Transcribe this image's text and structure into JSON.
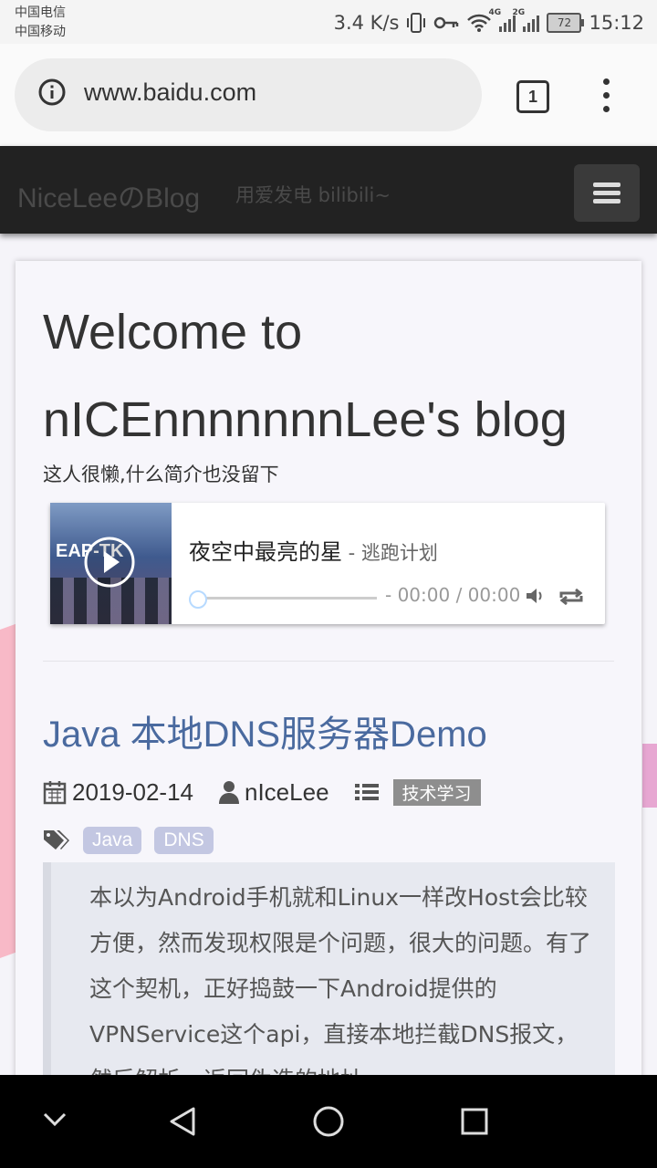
{
  "status": {
    "carrier1": "中国电信",
    "carrier2": "中国移动",
    "speed": "3.4 K/s",
    "net1": "4G",
    "net2": "2G",
    "battery": "72",
    "time": "15:12"
  },
  "browser": {
    "url": "www.baidu.com",
    "tab_count": "1"
  },
  "site": {
    "brand": "NiceLeeのBlog",
    "tagline": "用爱发电 bilibili~"
  },
  "intro": {
    "title": "Welcome to nICEnnnnnnnLee's blog",
    "description": "这人很懒,什么简介也没留下"
  },
  "player": {
    "cover_text": "EAP-TK",
    "song": "夜空中最亮的星",
    "artist": " - 逃跑计划",
    "time": "- 00:00 / 00:00",
    "progress": 0
  },
  "post": {
    "title": "Java 本地DNS服务器Demo",
    "date": "2019-02-14",
    "author": "nIceLee",
    "category": "技术学习",
    "tags": [
      "Java",
      "DNS"
    ],
    "excerpt": "本以为Android手机就和Linux一样改Host会比较方便，然而发现权限是个问题，很大的问题。有了这个契机，正好捣鼓一下Android提供的VPNService这个api，直接本地拦截DNS报文，然后解析，返回伪造的地址。"
  }
}
